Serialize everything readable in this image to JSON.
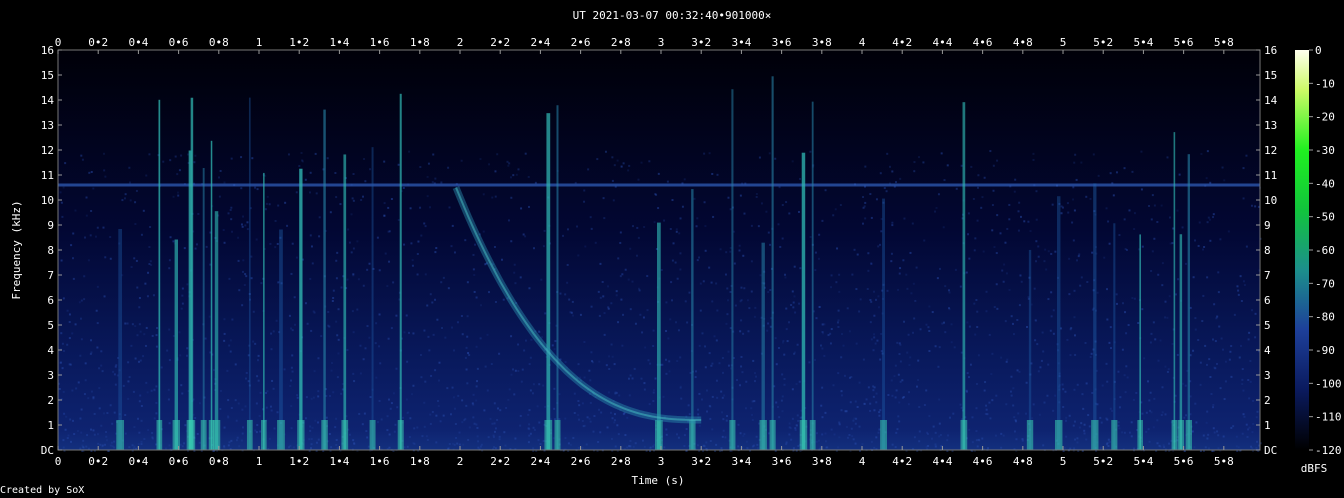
{
  "chart_data": {
    "type": "heatmap",
    "title": "UT 2021-03-07 00:32:40•901000×",
    "xlabel": "Time (s)",
    "ylabel": "Frequency (kHz)",
    "xlim": [
      0,
      5.98
    ],
    "ylim": [
      0,
      16
    ],
    "x_ticks": [
      "0",
      "0•2",
      "0•4",
      "0•6",
      "0•8",
      "1",
      "1•2",
      "1•4",
      "1•6",
      "1•8",
      "2",
      "2•2",
      "2•4",
      "2•6",
      "2•8",
      "3",
      "3•2",
      "3•4",
      "3•6",
      "3•8",
      "4",
      "4•2",
      "4•4",
      "4•6",
      "4•8",
      "5",
      "5•2",
      "5•4",
      "5•6",
      "5•8"
    ],
    "x_tick_values": [
      0,
      0.2,
      0.4,
      0.6,
      0.8,
      1,
      1.2,
      1.4,
      1.6,
      1.8,
      2,
      2.2,
      2.4,
      2.6,
      2.8,
      3,
      3.2,
      3.4,
      3.6,
      3.8,
      4,
      4.2,
      4.4,
      4.6,
      4.8,
      5,
      5.2,
      5.4,
      5.6,
      5.8
    ],
    "y_ticks": [
      "DC",
      "1",
      "2",
      "3",
      "4",
      "5",
      "6",
      "7",
      "8",
      "9",
      "10",
      "11",
      "12",
      "13",
      "14",
      "15",
      "16"
    ],
    "y_tick_values": [
      0,
      1,
      2,
      3,
      4,
      5,
      6,
      7,
      8,
      9,
      10,
      11,
      12,
      13,
      14,
      15,
      16
    ],
    "colorbar": {
      "label": "dBFS",
      "range": [
        -120,
        0
      ],
      "ticks": [
        "0",
        "-10",
        "-20",
        "-30",
        "-40",
        "-50",
        "-60",
        "-70",
        "-80",
        "-90",
        "-100",
        "-110",
        "-120"
      ],
      "tick_values": [
        0,
        -10,
        -20,
        -30,
        -40,
        -50,
        -60,
        -70,
        -80,
        -90,
        -100,
        -110,
        -120
      ]
    },
    "features": {
      "horizontal_tone_khz": 10.6,
      "whistler": {
        "start_s": 1.98,
        "start_khz": 10.5,
        "end_s": 3.2,
        "end_khz": 1.2
      },
      "sferics_s": [
        0.3,
        0.5,
        0.58,
        0.65,
        0.66,
        0.72,
        0.76,
        0.78,
        0.95,
        1.02,
        1.1,
        1.2,
        1.32,
        1.42,
        1.56,
        1.7,
        2.43,
        2.48,
        2.98,
        3.15,
        3.35,
        3.5,
        3.55,
        3.7,
        3.75,
        4.1,
        4.5,
        4.83,
        4.97,
        5.15,
        5.25,
        5.38,
        5.55,
        5.58,
        5.62
      ]
    },
    "grid": false
  },
  "footer": {
    "credit": "Created by SoX"
  },
  "colors": {
    "background": "#000000",
    "noise": "#0d1f6a",
    "signal": "#2aa0a0",
    "text": "#ffffff"
  }
}
